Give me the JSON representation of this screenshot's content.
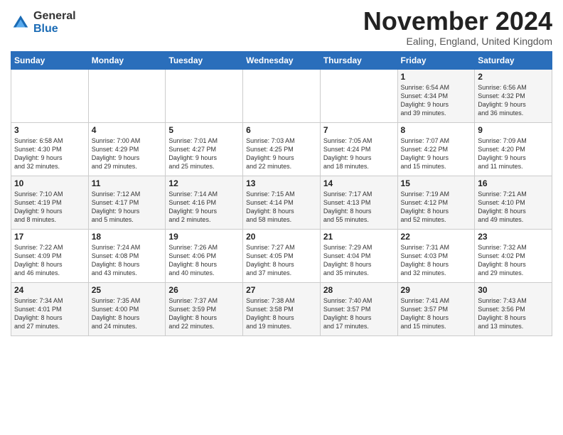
{
  "header": {
    "logo_general": "General",
    "logo_blue": "Blue",
    "month_title": "November 2024",
    "location": "Ealing, England, United Kingdom"
  },
  "days_of_week": [
    "Sunday",
    "Monday",
    "Tuesday",
    "Wednesday",
    "Thursday",
    "Friday",
    "Saturday"
  ],
  "weeks": [
    [
      {
        "day": "",
        "info": ""
      },
      {
        "day": "",
        "info": ""
      },
      {
        "day": "",
        "info": ""
      },
      {
        "day": "",
        "info": ""
      },
      {
        "day": "",
        "info": ""
      },
      {
        "day": "1",
        "info": "Sunrise: 6:54 AM\nSunset: 4:34 PM\nDaylight: 9 hours\nand 39 minutes."
      },
      {
        "day": "2",
        "info": "Sunrise: 6:56 AM\nSunset: 4:32 PM\nDaylight: 9 hours\nand 36 minutes."
      }
    ],
    [
      {
        "day": "3",
        "info": "Sunrise: 6:58 AM\nSunset: 4:30 PM\nDaylight: 9 hours\nand 32 minutes."
      },
      {
        "day": "4",
        "info": "Sunrise: 7:00 AM\nSunset: 4:29 PM\nDaylight: 9 hours\nand 29 minutes."
      },
      {
        "day": "5",
        "info": "Sunrise: 7:01 AM\nSunset: 4:27 PM\nDaylight: 9 hours\nand 25 minutes."
      },
      {
        "day": "6",
        "info": "Sunrise: 7:03 AM\nSunset: 4:25 PM\nDaylight: 9 hours\nand 22 minutes."
      },
      {
        "day": "7",
        "info": "Sunrise: 7:05 AM\nSunset: 4:24 PM\nDaylight: 9 hours\nand 18 minutes."
      },
      {
        "day": "8",
        "info": "Sunrise: 7:07 AM\nSunset: 4:22 PM\nDaylight: 9 hours\nand 15 minutes."
      },
      {
        "day": "9",
        "info": "Sunrise: 7:09 AM\nSunset: 4:20 PM\nDaylight: 9 hours\nand 11 minutes."
      }
    ],
    [
      {
        "day": "10",
        "info": "Sunrise: 7:10 AM\nSunset: 4:19 PM\nDaylight: 9 hours\nand 8 minutes."
      },
      {
        "day": "11",
        "info": "Sunrise: 7:12 AM\nSunset: 4:17 PM\nDaylight: 9 hours\nand 5 minutes."
      },
      {
        "day": "12",
        "info": "Sunrise: 7:14 AM\nSunset: 4:16 PM\nDaylight: 9 hours\nand 2 minutes."
      },
      {
        "day": "13",
        "info": "Sunrise: 7:15 AM\nSunset: 4:14 PM\nDaylight: 8 hours\nand 58 minutes."
      },
      {
        "day": "14",
        "info": "Sunrise: 7:17 AM\nSunset: 4:13 PM\nDaylight: 8 hours\nand 55 minutes."
      },
      {
        "day": "15",
        "info": "Sunrise: 7:19 AM\nSunset: 4:12 PM\nDaylight: 8 hours\nand 52 minutes."
      },
      {
        "day": "16",
        "info": "Sunrise: 7:21 AM\nSunset: 4:10 PM\nDaylight: 8 hours\nand 49 minutes."
      }
    ],
    [
      {
        "day": "17",
        "info": "Sunrise: 7:22 AM\nSunset: 4:09 PM\nDaylight: 8 hours\nand 46 minutes."
      },
      {
        "day": "18",
        "info": "Sunrise: 7:24 AM\nSunset: 4:08 PM\nDaylight: 8 hours\nand 43 minutes."
      },
      {
        "day": "19",
        "info": "Sunrise: 7:26 AM\nSunset: 4:06 PM\nDaylight: 8 hours\nand 40 minutes."
      },
      {
        "day": "20",
        "info": "Sunrise: 7:27 AM\nSunset: 4:05 PM\nDaylight: 8 hours\nand 37 minutes."
      },
      {
        "day": "21",
        "info": "Sunrise: 7:29 AM\nSunset: 4:04 PM\nDaylight: 8 hours\nand 35 minutes."
      },
      {
        "day": "22",
        "info": "Sunrise: 7:31 AM\nSunset: 4:03 PM\nDaylight: 8 hours\nand 32 minutes."
      },
      {
        "day": "23",
        "info": "Sunrise: 7:32 AM\nSunset: 4:02 PM\nDaylight: 8 hours\nand 29 minutes."
      }
    ],
    [
      {
        "day": "24",
        "info": "Sunrise: 7:34 AM\nSunset: 4:01 PM\nDaylight: 8 hours\nand 27 minutes."
      },
      {
        "day": "25",
        "info": "Sunrise: 7:35 AM\nSunset: 4:00 PM\nDaylight: 8 hours\nand 24 minutes."
      },
      {
        "day": "26",
        "info": "Sunrise: 7:37 AM\nSunset: 3:59 PM\nDaylight: 8 hours\nand 22 minutes."
      },
      {
        "day": "27",
        "info": "Sunrise: 7:38 AM\nSunset: 3:58 PM\nDaylight: 8 hours\nand 19 minutes."
      },
      {
        "day": "28",
        "info": "Sunrise: 7:40 AM\nSunset: 3:57 PM\nDaylight: 8 hours\nand 17 minutes."
      },
      {
        "day": "29",
        "info": "Sunrise: 7:41 AM\nSunset: 3:57 PM\nDaylight: 8 hours\nand 15 minutes."
      },
      {
        "day": "30",
        "info": "Sunrise: 7:43 AM\nSunset: 3:56 PM\nDaylight: 8 hours\nand 13 minutes."
      }
    ]
  ]
}
